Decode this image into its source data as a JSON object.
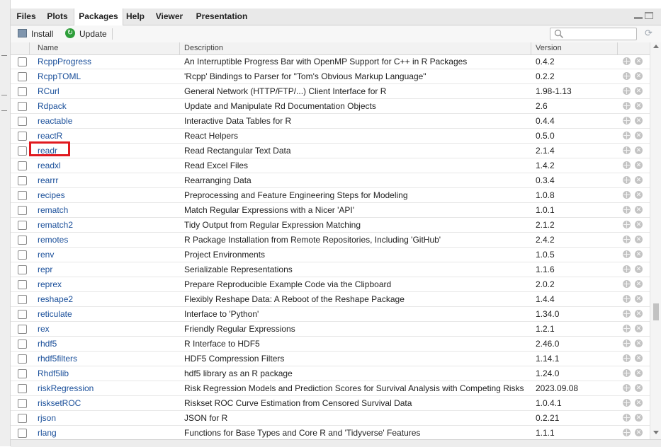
{
  "tabs": [
    "Files",
    "Plots",
    "Packages",
    "Help",
    "Viewer",
    "Presentation"
  ],
  "active_tab": "Packages",
  "toolbar": {
    "install_label": "Install",
    "update_label": "Update",
    "search_placeholder": ""
  },
  "columns": {
    "name": "Name",
    "description": "Description",
    "version": "Version"
  },
  "highlighted_package": "readr",
  "colors": {
    "link": "#1a4f9a",
    "highlight_border": "#e0191f",
    "update_icon": "#2e9e3a"
  },
  "packages": [
    {
      "name": "RcppProgress",
      "description": "An Interruptible Progress Bar with OpenMP Support for C++ in R Packages",
      "version": "0.4.2"
    },
    {
      "name": "RcppTOML",
      "description": "'Rcpp' Bindings to Parser for \"Tom's Obvious Markup Language\"",
      "version": "0.2.2"
    },
    {
      "name": "RCurl",
      "description": "General Network (HTTP/FTP/...) Client Interface for R",
      "version": "1.98-1.13"
    },
    {
      "name": "Rdpack",
      "description": "Update and Manipulate Rd Documentation Objects",
      "version": "2.6"
    },
    {
      "name": "reactable",
      "description": "Interactive Data Tables for R",
      "version": "0.4.4"
    },
    {
      "name": "reactR",
      "description": "React Helpers",
      "version": "0.5.0"
    },
    {
      "name": "readr",
      "description": "Read Rectangular Text Data",
      "version": "2.1.4"
    },
    {
      "name": "readxl",
      "description": "Read Excel Files",
      "version": "1.4.2"
    },
    {
      "name": "rearrr",
      "description": "Rearranging Data",
      "version": "0.3.4"
    },
    {
      "name": "recipes",
      "description": "Preprocessing and Feature Engineering Steps for Modeling",
      "version": "1.0.8"
    },
    {
      "name": "rematch",
      "description": "Match Regular Expressions with a Nicer 'API'",
      "version": "1.0.1"
    },
    {
      "name": "rematch2",
      "description": "Tidy Output from Regular Expression Matching",
      "version": "2.1.2"
    },
    {
      "name": "remotes",
      "description": "R Package Installation from Remote Repositories, Including 'GitHub'",
      "version": "2.4.2"
    },
    {
      "name": "renv",
      "description": "Project Environments",
      "version": "1.0.5"
    },
    {
      "name": "repr",
      "description": "Serializable Representations",
      "version": "1.1.6"
    },
    {
      "name": "reprex",
      "description": "Prepare Reproducible Example Code via the Clipboard",
      "version": "2.0.2"
    },
    {
      "name": "reshape2",
      "description": "Flexibly Reshape Data: A Reboot of the Reshape Package",
      "version": "1.4.4"
    },
    {
      "name": "reticulate",
      "description": "Interface to 'Python'",
      "version": "1.34.0"
    },
    {
      "name": "rex",
      "description": "Friendly Regular Expressions",
      "version": "1.2.1"
    },
    {
      "name": "rhdf5",
      "description": "R Interface to HDF5",
      "version": "2.46.0"
    },
    {
      "name": "rhdf5filters",
      "description": "HDF5 Compression Filters",
      "version": "1.14.1"
    },
    {
      "name": "Rhdf5lib",
      "description": "hdf5 library as an R package",
      "version": "1.24.0"
    },
    {
      "name": "riskRegression",
      "description": "Risk Regression Models and Prediction Scores for Survival Analysis with Competing Risks",
      "version": "2023.09.08"
    },
    {
      "name": "risksetROC",
      "description": "Riskset ROC Curve Estimation from Censored Survival Data",
      "version": "1.0.4.1"
    },
    {
      "name": "rjson",
      "description": "JSON for R",
      "version": "0.2.21"
    },
    {
      "name": "rlang",
      "description": "Functions for Base Types and Core R and 'Tidyverse' Features",
      "version": "1.1.1"
    }
  ]
}
